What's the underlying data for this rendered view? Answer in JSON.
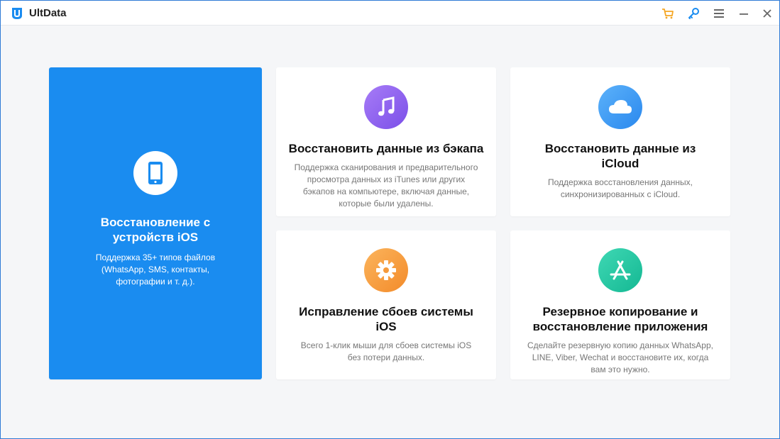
{
  "app": {
    "title": "UltData"
  },
  "titlebar": {
    "icons": [
      "cart-icon",
      "key-icon",
      "menu-icon",
      "minimize-icon",
      "close-icon"
    ],
    "accent_cart": "#f5a623",
    "accent_key": "#1a8cf0"
  },
  "cards": {
    "ios": {
      "title": "Восстановление с устройств iOS",
      "desc": "Поддержка 35+ типов файлов (WhatsApp, SMS, контакты, фотографии и т. д.).",
      "icon": "phone-icon",
      "color": "#1a8cf0"
    },
    "backup": {
      "title": "Восстановить данные из бэкапа",
      "desc": "Поддержка сканирования и предварительного просмотра данных из iTunes или других бэкапов на компьютере, включая данные, которые были удалены.",
      "icon": "music-note-icon",
      "color": "#8a5cf0"
    },
    "icloud": {
      "title": "Восстановить данные из iCloud",
      "desc": "Поддержка восстановления данных, синхронизированных с iCloud.",
      "icon": "cloud-icon",
      "color": "#3d9bf5"
    },
    "repair": {
      "title": "Исправление сбоев системы iOS",
      "desc": "Всего 1-клик мыши для сбоев системы iOS без потери данных.",
      "icon": "gear-icon",
      "color": "#f59a3c"
    },
    "apps": {
      "title": "Резервное копирование и восстановление приложения",
      "desc": "Сделайте резервную копию данных WhatsApp, LINE, Viber, Wechat и восстановите их, когда вам это нужно.",
      "icon": "app-store-icon",
      "color": "#1fc6a3"
    }
  }
}
